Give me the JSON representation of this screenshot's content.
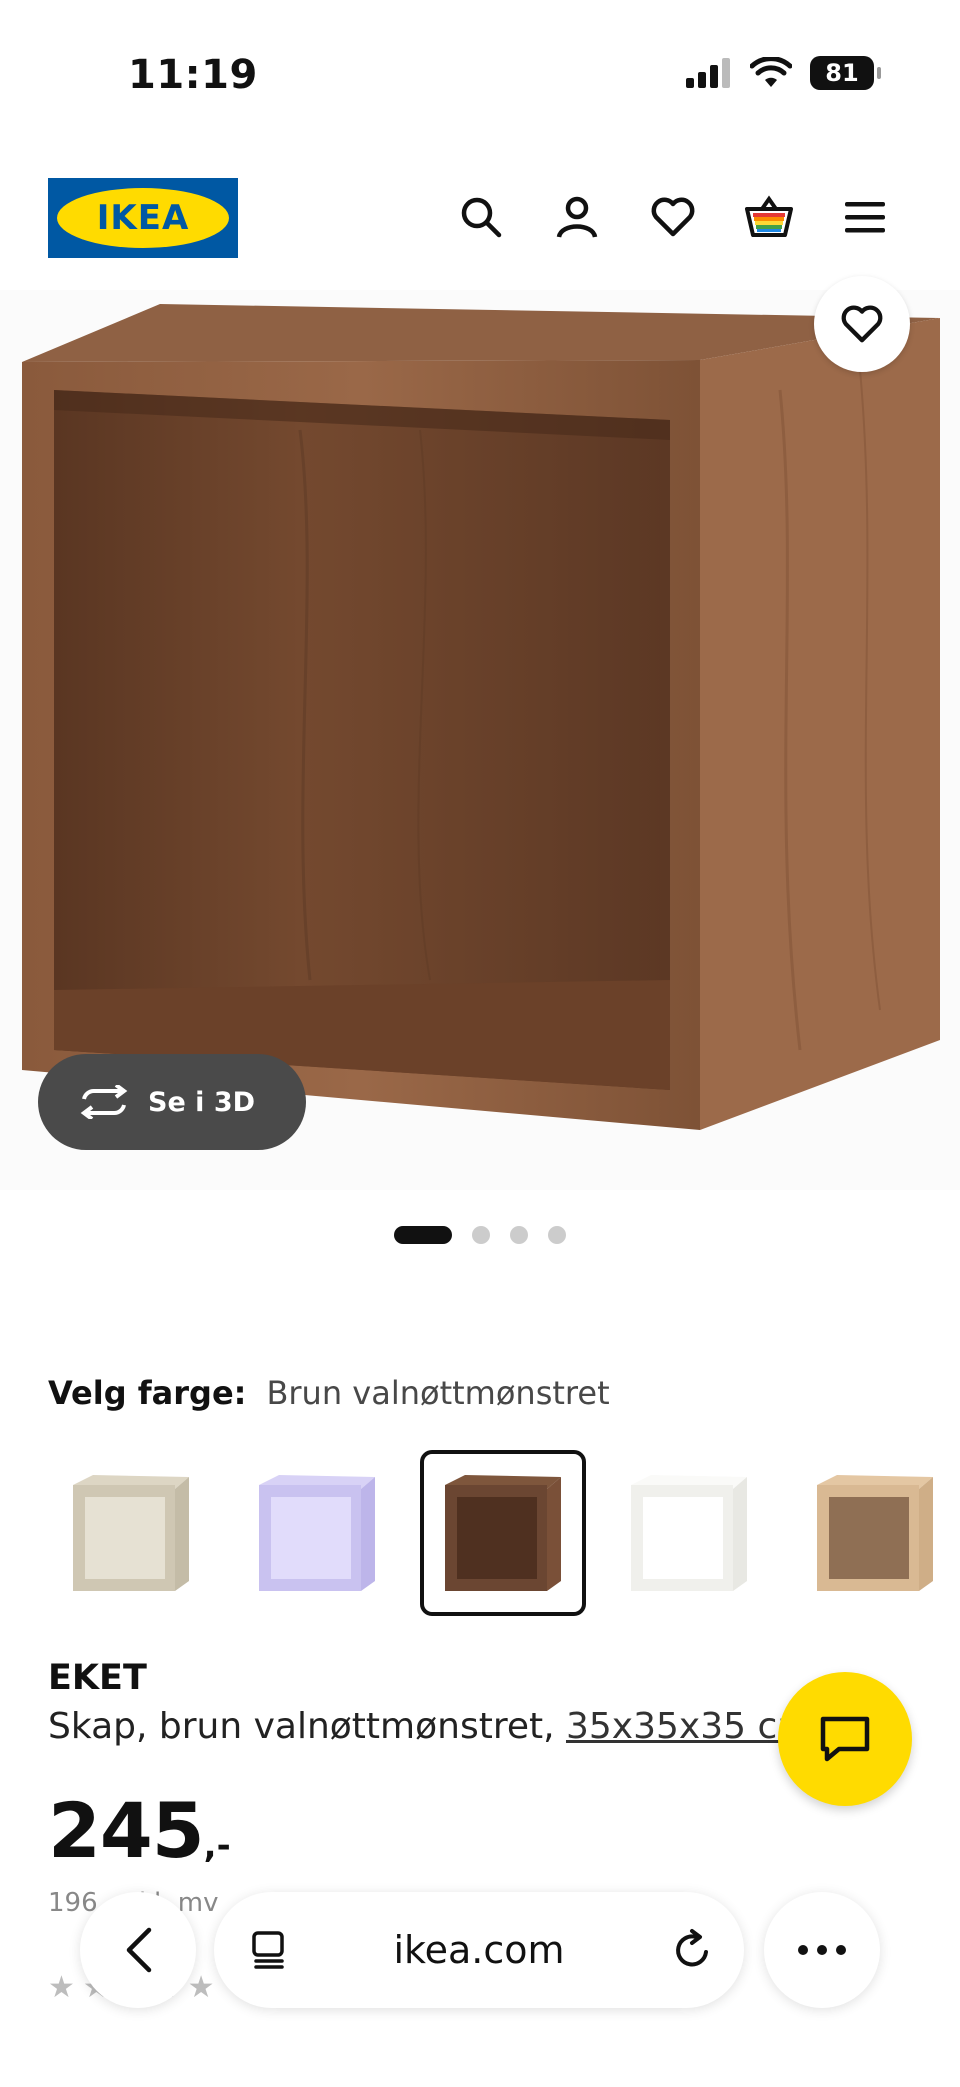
{
  "status_bar": {
    "time": "11:19",
    "battery": "81"
  },
  "header": {
    "logo_text": "IKEA"
  },
  "hero": {
    "view_3d_label": "Se i 3D",
    "image_count": 4,
    "active_image": 1
  },
  "color": {
    "label": "Velg farge:",
    "selected": "Brun valnøttmønstret",
    "swatches": [
      {
        "color": "#cfc7b3",
        "inner": "#e6e1d3",
        "selected": false
      },
      {
        "color": "#c9c2f0",
        "inner": "#e1dcfb",
        "selected": false
      },
      {
        "color": "#6b4632",
        "inner": "#7e563c",
        "selected": true
      },
      {
        "color": "#f3f3f0",
        "inner": "#ffffff",
        "selected": false
      },
      {
        "color": "#d9b993",
        "inner": "#b9977a",
        "selected": false
      }
    ]
  },
  "product": {
    "name": "EKET",
    "description": "Skap, brun valnøttmønstret, ",
    "measure": "35x35x35 cm",
    "price": "245",
    "price_suffix": ",-",
    "vat_note": "196 ... kl. mv",
    "rating_stars": "★★★★★"
  },
  "browser": {
    "url": "ikea.com"
  },
  "colors": {
    "ikea_blue": "#0058a3",
    "ikea_yellow": "#ffdb00"
  }
}
